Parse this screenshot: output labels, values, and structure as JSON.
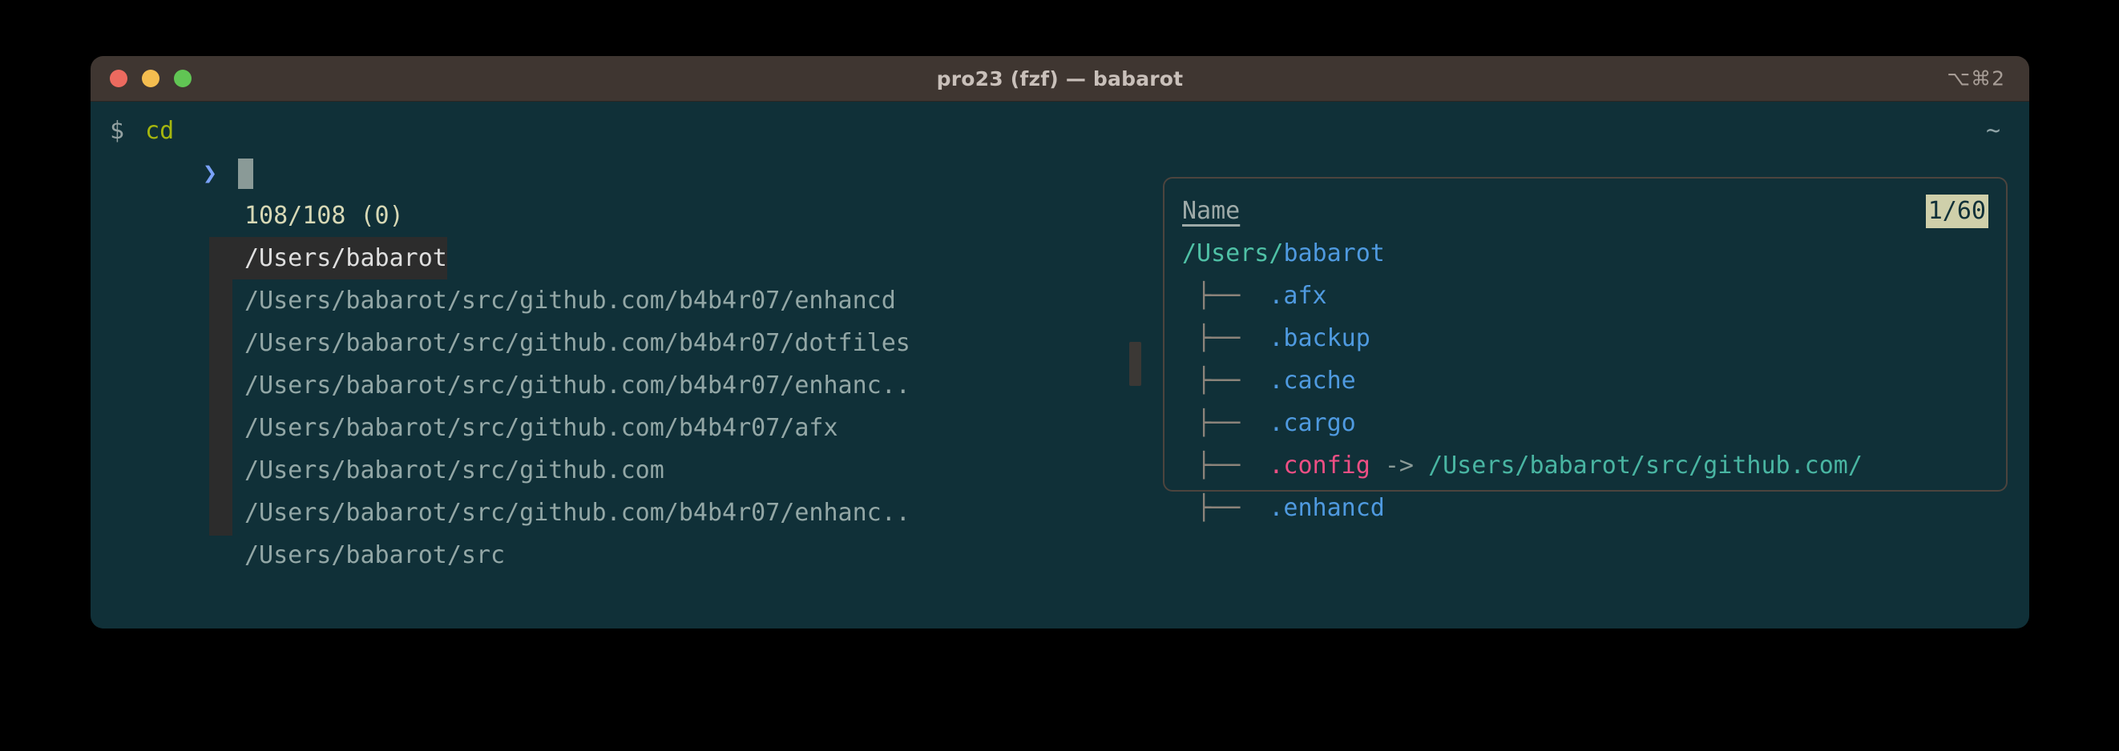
{
  "window": {
    "title": "pro23 (fzf) — babarot",
    "shortcut": "⌥⌘2",
    "traffic_lights": [
      "close-button",
      "minimize-button",
      "maximize-button"
    ],
    "colors": {
      "titlebar_bg": "#3f3631",
      "terminal_bg": "#103038",
      "accent_pink": "#ee4f84",
      "accent_blue": "#4f9ae0",
      "accent_green": "#4fc1a6",
      "badge_bg": "#cfcfaa",
      "selection_bg": "#2c2c2c",
      "close_dot": "#ec6a5f",
      "minimize_dot": "#f4bd4f",
      "maximize_dot": "#61c554"
    }
  },
  "shell": {
    "sigil": "$",
    "command": "cd",
    "right_marker": "~"
  },
  "fzf": {
    "prompt_symbol": "❯",
    "query": "",
    "cursor": "block",
    "counter": "108/108 (0)",
    "pointer": "▶",
    "results": [
      {
        "text": "/Users/babarot",
        "selected": true
      },
      {
        "text": "/Users/babarot/src/github.com/b4b4r07/enhancd",
        "selected": false
      },
      {
        "text": "/Users/babarot/src/github.com/b4b4r07/dotfiles",
        "selected": false
      },
      {
        "text": "/Users/babarot/src/github.com/b4b4r07/enhanc..",
        "selected": false
      },
      {
        "text": "/Users/babarot/src/github.com/b4b4r07/afx",
        "selected": false
      },
      {
        "text": "/Users/babarot/src/github.com",
        "selected": false
      },
      {
        "text": "/Users/babarot/src/github.com/b4b4r07/enhanc..",
        "selected": false
      },
      {
        "text": "/Users/babarot/src",
        "selected": false
      }
    ]
  },
  "preview": {
    "title": "Name",
    "badge": "1/60",
    "root": {
      "prefix": "/Users/",
      "name": "babarot"
    },
    "entries": [
      {
        "branch": "├──",
        "name": ".afx",
        "kind": "dir",
        "link_arrow": "",
        "link_target": ""
      },
      {
        "branch": "├──",
        "name": ".backup",
        "kind": "dir",
        "link_arrow": "",
        "link_target": ""
      },
      {
        "branch": "├──",
        "name": ".cache",
        "kind": "dir",
        "link_arrow": "",
        "link_target": ""
      },
      {
        "branch": "├──",
        "name": ".cargo",
        "kind": "dir",
        "link_arrow": "",
        "link_target": ""
      },
      {
        "branch": "├──",
        "name": ".config",
        "kind": "symlink",
        "link_arrow": "->",
        "link_target": "/Users/babarot/src/github.com/"
      },
      {
        "branch": "├──",
        "name": ".enhancd",
        "kind": "dir",
        "link_arrow": "",
        "link_target": ""
      }
    ]
  }
}
